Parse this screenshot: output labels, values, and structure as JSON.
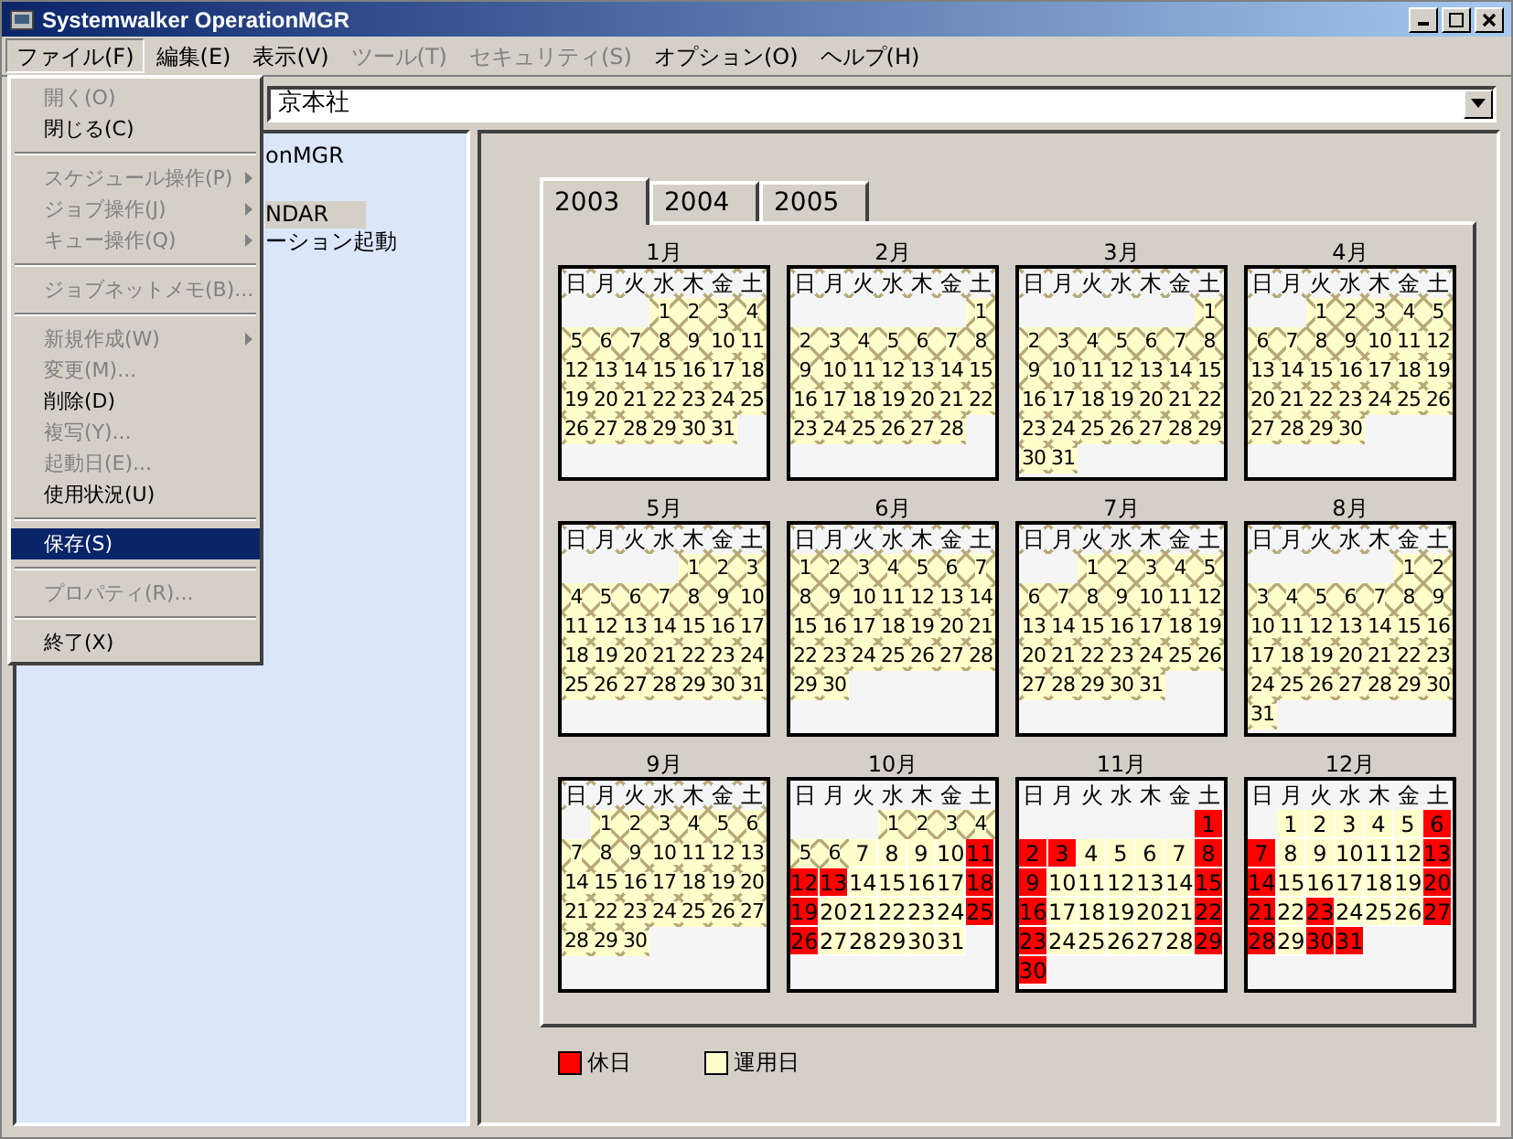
{
  "window": {
    "title": "Systemwalker OperationMGR"
  },
  "menubar": [
    {
      "label": "ファイル(F)",
      "selected": true,
      "disabled": false
    },
    {
      "label": "編集(E)",
      "selected": false,
      "disabled": false
    },
    {
      "label": "表示(V)",
      "selected": false,
      "disabled": false
    },
    {
      "label": "ツール(T)",
      "selected": false,
      "disabled": true
    },
    {
      "label": "セキュリティ(S)",
      "selected": false,
      "disabled": true
    },
    {
      "label": "オプション(O)",
      "selected": false,
      "disabled": false
    },
    {
      "label": "ヘルプ(H)",
      "selected": false,
      "disabled": false
    }
  ],
  "file_menu": [
    {
      "kind": "item",
      "label": "開く(O)",
      "disabled": true,
      "submenu": false,
      "selected": false
    },
    {
      "kind": "item",
      "label": "閉じる(C)",
      "disabled": false,
      "submenu": false,
      "selected": false
    },
    {
      "kind": "separator"
    },
    {
      "kind": "item",
      "label": "スケジュール操作(P)",
      "disabled": true,
      "submenu": true,
      "selected": false
    },
    {
      "kind": "item",
      "label": "ジョブ操作(J)",
      "disabled": true,
      "submenu": true,
      "selected": false
    },
    {
      "kind": "item",
      "label": "キュー操作(Q)",
      "disabled": true,
      "submenu": true,
      "selected": false
    },
    {
      "kind": "separator"
    },
    {
      "kind": "item",
      "label": "ジョブネットメモ(B)...",
      "disabled": true,
      "submenu": false,
      "selected": false
    },
    {
      "kind": "separator"
    },
    {
      "kind": "item",
      "label": "新規作成(W)",
      "disabled": true,
      "submenu": true,
      "selected": false
    },
    {
      "kind": "item",
      "label": "変更(M)...",
      "disabled": true,
      "submenu": false,
      "selected": false
    },
    {
      "kind": "item",
      "label": "削除(D)",
      "disabled": false,
      "submenu": false,
      "selected": false
    },
    {
      "kind": "item",
      "label": "複写(Y)...",
      "disabled": true,
      "submenu": false,
      "selected": false
    },
    {
      "kind": "item",
      "label": "起動日(E)...",
      "disabled": true,
      "submenu": false,
      "selected": false
    },
    {
      "kind": "item",
      "label": "使用状況(U)",
      "disabled": false,
      "submenu": false,
      "selected": false
    },
    {
      "kind": "separator"
    },
    {
      "kind": "item",
      "label": "保存(S)",
      "disabled": false,
      "submenu": false,
      "selected": true
    },
    {
      "kind": "separator"
    },
    {
      "kind": "item",
      "label": "プロパティ(R)...",
      "disabled": true,
      "submenu": false,
      "selected": false
    },
    {
      "kind": "separator"
    },
    {
      "kind": "item",
      "label": "終了(X)",
      "disabled": false,
      "submenu": false,
      "selected": false
    }
  ],
  "host_combo": {
    "value": "京本社"
  },
  "tree": [
    {
      "label": "onMGR",
      "selected": false
    },
    {
      "label": "NDAR",
      "selected": true
    },
    {
      "label": "ーション起動",
      "selected": false
    }
  ],
  "year_tabs": [
    {
      "label": "2003",
      "selected": true
    },
    {
      "label": "2004",
      "selected": false
    },
    {
      "label": "2005",
      "selected": false
    }
  ],
  "months": [
    {
      "label": "1月",
      "header_crossed": true,
      "weekdays": [
        "日",
        "月",
        "火",
        "水",
        "木",
        "金",
        "土"
      ],
      "days": [
        {
          "kind": "blank"
        },
        {
          "kind": "blank"
        },
        {
          "kind": "blank"
        },
        {
          "day": "1",
          "kind": "past"
        },
        {
          "day": "2",
          "kind": "past"
        },
        {
          "day": "3",
          "kind": "past"
        },
        {
          "day": "4",
          "kind": "past"
        },
        {
          "day": "5",
          "kind": "past"
        },
        {
          "day": "6",
          "kind": "past"
        },
        {
          "day": "7",
          "kind": "past"
        },
        {
          "day": "8",
          "kind": "past"
        },
        {
          "day": "9",
          "kind": "past"
        },
        {
          "day": "10",
          "kind": "past"
        },
        {
          "day": "11",
          "kind": "past"
        },
        {
          "day": "12",
          "kind": "past"
        },
        {
          "day": "13",
          "kind": "past"
        },
        {
          "day": "14",
          "kind": "past"
        },
        {
          "day": "15",
          "kind": "past"
        },
        {
          "day": "16",
          "kind": "past"
        },
        {
          "day": "17",
          "kind": "past"
        },
        {
          "day": "18",
          "kind": "past"
        },
        {
          "day": "19",
          "kind": "past"
        },
        {
          "day": "20",
          "kind": "past"
        },
        {
          "day": "21",
          "kind": "past"
        },
        {
          "day": "22",
          "kind": "past"
        },
        {
          "day": "23",
          "kind": "past"
        },
        {
          "day": "24",
          "kind": "past"
        },
        {
          "day": "25",
          "kind": "past"
        },
        {
          "day": "26",
          "kind": "past"
        },
        {
          "day": "27",
          "kind": "past"
        },
        {
          "day": "28",
          "kind": "past"
        },
        {
          "day": "29",
          "kind": "past"
        },
        {
          "day": "30",
          "kind": "past"
        },
        {
          "day": "31",
          "kind": "past"
        }
      ]
    },
    {
      "label": "2月",
      "header_crossed": true,
      "weekdays": [
        "日",
        "月",
        "火",
        "水",
        "木",
        "金",
        "土"
      ],
      "days": [
        {
          "kind": "blank"
        },
        {
          "kind": "blank"
        },
        {
          "kind": "blank"
        },
        {
          "kind": "blank"
        },
        {
          "kind": "blank"
        },
        {
          "kind": "blank"
        },
        {
          "day": "1",
          "kind": "past"
        },
        {
          "day": "2",
          "kind": "past"
        },
        {
          "day": "3",
          "kind": "past"
        },
        {
          "day": "4",
          "kind": "past"
        },
        {
          "day": "5",
          "kind": "past"
        },
        {
          "day": "6",
          "kind": "past"
        },
        {
          "day": "7",
          "kind": "past"
        },
        {
          "day": "8",
          "kind": "past"
        },
        {
          "day": "9",
          "kind": "past"
        },
        {
          "day": "10",
          "kind": "past"
        },
        {
          "day": "11",
          "kind": "past"
        },
        {
          "day": "12",
          "kind": "past"
        },
        {
          "day": "13",
          "kind": "past"
        },
        {
          "day": "14",
          "kind": "past"
        },
        {
          "day": "15",
          "kind": "past"
        },
        {
          "day": "16",
          "kind": "past"
        },
        {
          "day": "17",
          "kind": "past"
        },
        {
          "day": "18",
          "kind": "past"
        },
        {
          "day": "19",
          "kind": "past"
        },
        {
          "day": "20",
          "kind": "past"
        },
        {
          "day": "21",
          "kind": "past"
        },
        {
          "day": "22",
          "kind": "past"
        },
        {
          "day": "23",
          "kind": "past"
        },
        {
          "day": "24",
          "kind": "past"
        },
        {
          "day": "25",
          "kind": "past"
        },
        {
          "day": "26",
          "kind": "past"
        },
        {
          "day": "27",
          "kind": "past"
        },
        {
          "day": "28",
          "kind": "past"
        }
      ]
    },
    {
      "label": "3月",
      "header_crossed": true,
      "weekdays": [
        "日",
        "月",
        "火",
        "水",
        "木",
        "金",
        "土"
      ],
      "days": [
        {
          "kind": "blank"
        },
        {
          "kind": "blank"
        },
        {
          "kind": "blank"
        },
        {
          "kind": "blank"
        },
        {
          "kind": "blank"
        },
        {
          "kind": "blank"
        },
        {
          "day": "1",
          "kind": "past"
        },
        {
          "day": "2",
          "kind": "past"
        },
        {
          "day": "3",
          "kind": "past"
        },
        {
          "day": "4",
          "kind": "past"
        },
        {
          "day": "5",
          "kind": "past"
        },
        {
          "day": "6",
          "kind": "past"
        },
        {
          "day": "7",
          "kind": "past"
        },
        {
          "day": "8",
          "kind": "past"
        },
        {
          "day": "9",
          "kind": "past"
        },
        {
          "day": "10",
          "kind": "past"
        },
        {
          "day": "11",
          "kind": "past"
        },
        {
          "day": "12",
          "kind": "past"
        },
        {
          "day": "13",
          "kind": "past"
        },
        {
          "day": "14",
          "kind": "past"
        },
        {
          "day": "15",
          "kind": "past"
        },
        {
          "day": "16",
          "kind": "past"
        },
        {
          "day": "17",
          "kind": "past"
        },
        {
          "day": "18",
          "kind": "past"
        },
        {
          "day": "19",
          "kind": "past"
        },
        {
          "day": "20",
          "kind": "past"
        },
        {
          "day": "21",
          "kind": "past"
        },
        {
          "day": "22",
          "kind": "past"
        },
        {
          "day": "23",
          "kind": "past"
        },
        {
          "day": "24",
          "kind": "past"
        },
        {
          "day": "25",
          "kind": "past"
        },
        {
          "day": "26",
          "kind": "past"
        },
        {
          "day": "27",
          "kind": "past"
        },
        {
          "day": "28",
          "kind": "past"
        },
        {
          "day": "29",
          "kind": "past"
        },
        {
          "day": "30",
          "kind": "past"
        },
        {
          "day": "31",
          "kind": "past"
        }
      ]
    },
    {
      "label": "4月",
      "header_crossed": true,
      "weekdays": [
        "日",
        "月",
        "火",
        "水",
        "木",
        "金",
        "土"
      ],
      "days": [
        {
          "kind": "blank"
        },
        {
          "kind": "blank"
        },
        {
          "day": "1",
          "kind": "past"
        },
        {
          "day": "2",
          "kind": "past"
        },
        {
          "day": "3",
          "kind": "past"
        },
        {
          "day": "4",
          "kind": "past"
        },
        {
          "day": "5",
          "kind": "past"
        },
        {
          "day": "6",
          "kind": "past"
        },
        {
          "day": "7",
          "kind": "past"
        },
        {
          "day": "8",
          "kind": "past"
        },
        {
          "day": "9",
          "kind": "past"
        },
        {
          "day": "10",
          "kind": "past"
        },
        {
          "day": "11",
          "kind": "past"
        },
        {
          "day": "12",
          "kind": "past"
        },
        {
          "day": "13",
          "kind": "past"
        },
        {
          "day": "14",
          "kind": "past"
        },
        {
          "day": "15",
          "kind": "past"
        },
        {
          "day": "16",
          "kind": "past"
        },
        {
          "day": "17",
          "kind": "past"
        },
        {
          "day": "18",
          "kind": "past"
        },
        {
          "day": "19",
          "kind": "past"
        },
        {
          "day": "20",
          "kind": "past"
        },
        {
          "day": "21",
          "kind": "past"
        },
        {
          "day": "22",
          "kind": "past"
        },
        {
          "day": "23",
          "kind": "past"
        },
        {
          "day": "24",
          "kind": "past"
        },
        {
          "day": "25",
          "kind": "past"
        },
        {
          "day": "26",
          "kind": "past"
        },
        {
          "day": "27",
          "kind": "past"
        },
        {
          "day": "28",
          "kind": "past"
        },
        {
          "day": "29",
          "kind": "past"
        },
        {
          "day": "30",
          "kind": "past"
        }
      ]
    },
    {
      "label": "5月",
      "header_crossed": true,
      "weekdays": [
        "日",
        "月",
        "火",
        "水",
        "木",
        "金",
        "土"
      ],
      "days": [
        {
          "kind": "blank"
        },
        {
          "kind": "blank"
        },
        {
          "kind": "blank"
        },
        {
          "kind": "blank"
        },
        {
          "day": "1",
          "kind": "past"
        },
        {
          "day": "2",
          "kind": "past"
        },
        {
          "day": "3",
          "kind": "past"
        },
        {
          "day": "4",
          "kind": "past"
        },
        {
          "day": "5",
          "kind": "past"
        },
        {
          "day": "6",
          "kind": "past"
        },
        {
          "day": "7",
          "kind": "past"
        },
        {
          "day": "8",
          "kind": "past"
        },
        {
          "day": "9",
          "kind": "past"
        },
        {
          "day": "10",
          "kind": "past"
        },
        {
          "day": "11",
          "kind": "past"
        },
        {
          "day": "12",
          "kind": "past"
        },
        {
          "day": "13",
          "kind": "past"
        },
        {
          "day": "14",
          "kind": "past"
        },
        {
          "day": "15",
          "kind": "past"
        },
        {
          "day": "16",
          "kind": "past"
        },
        {
          "day": "17",
          "kind": "past"
        },
        {
          "day": "18",
          "kind": "past"
        },
        {
          "day": "19",
          "kind": "past"
        },
        {
          "day": "20",
          "kind": "past"
        },
        {
          "day": "21",
          "kind": "past"
        },
        {
          "day": "22",
          "kind": "past"
        },
        {
          "day": "23",
          "kind": "past"
        },
        {
          "day": "24",
          "kind": "past"
        },
        {
          "day": "25",
          "kind": "past"
        },
        {
          "day": "26",
          "kind": "past"
        },
        {
          "day": "27",
          "kind": "past"
        },
        {
          "day": "28",
          "kind": "past"
        },
        {
          "day": "29",
          "kind": "past"
        },
        {
          "day": "30",
          "kind": "past"
        },
        {
          "day": "31",
          "kind": "past"
        }
      ]
    },
    {
      "label": "6月",
      "header_crossed": true,
      "weekdays": [
        "日",
        "月",
        "火",
        "水",
        "木",
        "金",
        "土"
      ],
      "days": [
        {
          "day": "1",
          "kind": "past"
        },
        {
          "day": "2",
          "kind": "past"
        },
        {
          "day": "3",
          "kind": "past"
        },
        {
          "day": "4",
          "kind": "past"
        },
        {
          "day": "5",
          "kind": "past"
        },
        {
          "day": "6",
          "kind": "past"
        },
        {
          "day": "7",
          "kind": "past"
        },
        {
          "day": "8",
          "kind": "past"
        },
        {
          "day": "9",
          "kind": "past"
        },
        {
          "day": "10",
          "kind": "past"
        },
        {
          "day": "11",
          "kind": "past"
        },
        {
          "day": "12",
          "kind": "past"
        },
        {
          "day": "13",
          "kind": "past"
        },
        {
          "day": "14",
          "kind": "past"
        },
        {
          "day": "15",
          "kind": "past"
        },
        {
          "day": "16",
          "kind": "past"
        },
        {
          "day": "17",
          "kind": "past"
        },
        {
          "day": "18",
          "kind": "past"
        },
        {
          "day": "19",
          "kind": "past"
        },
        {
          "day": "20",
          "kind": "past"
        },
        {
          "day": "21",
          "kind": "past"
        },
        {
          "day": "22",
          "kind": "past"
        },
        {
          "day": "23",
          "kind": "past"
        },
        {
          "day": "24",
          "kind": "past"
        },
        {
          "day": "25",
          "kind": "past"
        },
        {
          "day": "26",
          "kind": "past"
        },
        {
          "day": "27",
          "kind": "past"
        },
        {
          "day": "28",
          "kind": "past"
        },
        {
          "day": "29",
          "kind": "past"
        },
        {
          "day": "30",
          "kind": "past"
        }
      ]
    },
    {
      "label": "7月",
      "header_crossed": true,
      "weekdays": [
        "日",
        "月",
        "火",
        "水",
        "木",
        "金",
        "土"
      ],
      "days": [
        {
          "kind": "blank"
        },
        {
          "kind": "blank"
        },
        {
          "day": "1",
          "kind": "past"
        },
        {
          "day": "2",
          "kind": "past"
        },
        {
          "day": "3",
          "kind": "past"
        },
        {
          "day": "4",
          "kind": "past"
        },
        {
          "day": "5",
          "kind": "past"
        },
        {
          "day": "6",
          "kind": "past"
        },
        {
          "day": "7",
          "kind": "past"
        },
        {
          "day": "8",
          "kind": "past"
        },
        {
          "day": "9",
          "kind": "past"
        },
        {
          "day": "10",
          "kind": "past"
        },
        {
          "day": "11",
          "kind": "past"
        },
        {
          "day": "12",
          "kind": "past"
        },
        {
          "day": "13",
          "kind": "past"
        },
        {
          "day": "14",
          "kind": "past"
        },
        {
          "day": "15",
          "kind": "past"
        },
        {
          "day": "16",
          "kind": "past"
        },
        {
          "day": "17",
          "kind": "past"
        },
        {
          "day": "18",
          "kind": "past"
        },
        {
          "day": "19",
          "kind": "past"
        },
        {
          "day": "20",
          "kind": "past"
        },
        {
          "day": "21",
          "kind": "past"
        },
        {
          "day": "22",
          "kind": "past"
        },
        {
          "day": "23",
          "kind": "past"
        },
        {
          "day": "24",
          "kind": "past"
        },
        {
          "day": "25",
          "kind": "past"
        },
        {
          "day": "26",
          "kind": "past"
        },
        {
          "day": "27",
          "kind": "past"
        },
        {
          "day": "28",
          "kind": "past"
        },
        {
          "day": "29",
          "kind": "past"
        },
        {
          "day": "30",
          "kind": "past"
        },
        {
          "day": "31",
          "kind": "past"
        }
      ]
    },
    {
      "label": "8月",
      "header_crossed": true,
      "weekdays": [
        "日",
        "月",
        "火",
        "水",
        "木",
        "金",
        "土"
      ],
      "days": [
        {
          "kind": "blank"
        },
        {
          "kind": "blank"
        },
        {
          "kind": "blank"
        },
        {
          "kind": "blank"
        },
        {
          "kind": "blank"
        },
        {
          "day": "1",
          "kind": "past"
        },
        {
          "day": "2",
          "kind": "past"
        },
        {
          "day": "3",
          "kind": "past"
        },
        {
          "day": "4",
          "kind": "past"
        },
        {
          "day": "5",
          "kind": "past"
        },
        {
          "day": "6",
          "kind": "past"
        },
        {
          "day": "7",
          "kind": "past"
        },
        {
          "day": "8",
          "kind": "past"
        },
        {
          "day": "9",
          "kind": "past"
        },
        {
          "day": "10",
          "kind": "past"
        },
        {
          "day": "11",
          "kind": "past"
        },
        {
          "day": "12",
          "kind": "past"
        },
        {
          "day": "13",
          "kind": "past"
        },
        {
          "day": "14",
          "kind": "past"
        },
        {
          "day": "15",
          "kind": "past"
        },
        {
          "day": "16",
          "kind": "past"
        },
        {
          "day": "17",
          "kind": "past"
        },
        {
          "day": "18",
          "kind": "past"
        },
        {
          "day": "19",
          "kind": "past"
        },
        {
          "day": "20",
          "kind": "past"
        },
        {
          "day": "21",
          "kind": "past"
        },
        {
          "day": "22",
          "kind": "past"
        },
        {
          "day": "23",
          "kind": "past"
        },
        {
          "day": "24",
          "kind": "past"
        },
        {
          "day": "25",
          "kind": "past"
        },
        {
          "day": "26",
          "kind": "past"
        },
        {
          "day": "27",
          "kind": "past"
        },
        {
          "day": "28",
          "kind": "past"
        },
        {
          "day": "29",
          "kind": "past"
        },
        {
          "day": "30",
          "kind": "past"
        },
        {
          "day": "31",
          "kind": "past"
        }
      ]
    },
    {
      "label": "9月",
      "header_crossed": true,
      "weekdays": [
        "日",
        "月",
        "火",
        "水",
        "木",
        "金",
        "土"
      ],
      "days": [
        {
          "kind": "blank"
        },
        {
          "day": "1",
          "kind": "past"
        },
        {
          "day": "2",
          "kind": "past"
        },
        {
          "day": "3",
          "kind": "past"
        },
        {
          "day": "4",
          "kind": "past"
        },
        {
          "day": "5",
          "kind": "past"
        },
        {
          "day": "6",
          "kind": "past"
        },
        {
          "day": "7",
          "kind": "past"
        },
        {
          "day": "8",
          "kind": "past"
        },
        {
          "day": "9",
          "kind": "past"
        },
        {
          "day": "10",
          "kind": "past"
        },
        {
          "day": "11",
          "kind": "past"
        },
        {
          "day": "12",
          "kind": "past"
        },
        {
          "day": "13",
          "kind": "past"
        },
        {
          "day": "14",
          "kind": "past"
        },
        {
          "day": "15",
          "kind": "past"
        },
        {
          "day": "16",
          "kind": "past"
        },
        {
          "day": "17",
          "kind": "past"
        },
        {
          "day": "18",
          "kind": "past"
        },
        {
          "day": "19",
          "kind": "past"
        },
        {
          "day": "20",
          "kind": "past"
        },
        {
          "day": "21",
          "kind": "past"
        },
        {
          "day": "22",
          "kind": "past"
        },
        {
          "day": "23",
          "kind": "past"
        },
        {
          "day": "24",
          "kind": "past"
        },
        {
          "day": "25",
          "kind": "past"
        },
        {
          "day": "26",
          "kind": "past"
        },
        {
          "day": "27",
          "kind": "past"
        },
        {
          "day": "28",
          "kind": "past"
        },
        {
          "day": "29",
          "kind": "past"
        },
        {
          "day": "30",
          "kind": "past"
        }
      ]
    },
    {
      "label": "10月",
      "header_crossed": false,
      "weekdays": [
        "日",
        "月",
        "火",
        "水",
        "木",
        "金",
        "土"
      ],
      "days": [
        {
          "kind": "blank"
        },
        {
          "kind": "blank"
        },
        {
          "kind": "blank"
        },
        {
          "day": "1",
          "kind": "past"
        },
        {
          "day": "2",
          "kind": "past"
        },
        {
          "day": "3",
          "kind": "past"
        },
        {
          "day": "4",
          "kind": "past"
        },
        {
          "day": "5",
          "kind": "past"
        },
        {
          "day": "6",
          "kind": "past"
        },
        {
          "day": "7",
          "kind": "workday"
        },
        {
          "day": "8",
          "kind": "workday"
        },
        {
          "day": "9",
          "kind": "workday"
        },
        {
          "day": "10",
          "kind": "workday"
        },
        {
          "day": "11",
          "kind": "holiday"
        },
        {
          "day": "12",
          "kind": "holiday"
        },
        {
          "day": "13",
          "kind": "holiday"
        },
        {
          "day": "14",
          "kind": "workday"
        },
        {
          "day": "15",
          "kind": "workday"
        },
        {
          "day": "16",
          "kind": "workday"
        },
        {
          "day": "17",
          "kind": "workday"
        },
        {
          "day": "18",
          "kind": "holiday"
        },
        {
          "day": "19",
          "kind": "holiday"
        },
        {
          "day": "20",
          "kind": "workday"
        },
        {
          "day": "21",
          "kind": "workday"
        },
        {
          "day": "22",
          "kind": "workday"
        },
        {
          "day": "23",
          "kind": "workday"
        },
        {
          "day": "24",
          "kind": "workday"
        },
        {
          "day": "25",
          "kind": "holiday"
        },
        {
          "day": "26",
          "kind": "holiday"
        },
        {
          "day": "27",
          "kind": "workday"
        },
        {
          "day": "28",
          "kind": "workday"
        },
        {
          "day": "29",
          "kind": "workday"
        },
        {
          "day": "30",
          "kind": "workday"
        },
        {
          "day": "31",
          "kind": "workday"
        }
      ]
    },
    {
      "label": "11月",
      "header_crossed": false,
      "weekdays": [
        "日",
        "月",
        "火",
        "水",
        "木",
        "金",
        "土"
      ],
      "days": [
        {
          "kind": "blank"
        },
        {
          "kind": "blank"
        },
        {
          "kind": "blank"
        },
        {
          "kind": "blank"
        },
        {
          "kind": "blank"
        },
        {
          "kind": "blank"
        },
        {
          "day": "1",
          "kind": "holiday"
        },
        {
          "day": "2",
          "kind": "holiday"
        },
        {
          "day": "3",
          "kind": "holiday"
        },
        {
          "day": "4",
          "kind": "workday"
        },
        {
          "day": "5",
          "kind": "workday"
        },
        {
          "day": "6",
          "kind": "workday"
        },
        {
          "day": "7",
          "kind": "workday"
        },
        {
          "day": "8",
          "kind": "holiday"
        },
        {
          "day": "9",
          "kind": "holiday"
        },
        {
          "day": "10",
          "kind": "workday"
        },
        {
          "day": "11",
          "kind": "workday"
        },
        {
          "day": "12",
          "kind": "workday"
        },
        {
          "day": "13",
          "kind": "workday"
        },
        {
          "day": "14",
          "kind": "workday"
        },
        {
          "day": "15",
          "kind": "holiday"
        },
        {
          "day": "16",
          "kind": "holiday"
        },
        {
          "day": "17",
          "kind": "workday"
        },
        {
          "day": "18",
          "kind": "workday"
        },
        {
          "day": "19",
          "kind": "workday"
        },
        {
          "day": "20",
          "kind": "workday"
        },
        {
          "day": "21",
          "kind": "workday"
        },
        {
          "day": "22",
          "kind": "holiday"
        },
        {
          "day": "23",
          "kind": "holiday"
        },
        {
          "day": "24",
          "kind": "workday"
        },
        {
          "day": "25",
          "kind": "workday"
        },
        {
          "day": "26",
          "kind": "workday"
        },
        {
          "day": "27",
          "kind": "workday"
        },
        {
          "day": "28",
          "kind": "workday"
        },
        {
          "day": "29",
          "kind": "holiday"
        },
        {
          "day": "30",
          "kind": "holiday"
        }
      ]
    },
    {
      "label": "12月",
      "header_crossed": false,
      "weekdays": [
        "日",
        "月",
        "火",
        "水",
        "木",
        "金",
        "土"
      ],
      "days": [
        {
          "kind": "blank"
        },
        {
          "day": "1",
          "kind": "workday"
        },
        {
          "day": "2",
          "kind": "workday"
        },
        {
          "day": "3",
          "kind": "workday"
        },
        {
          "day": "4",
          "kind": "workday"
        },
        {
          "day": "5",
          "kind": "workday"
        },
        {
          "day": "6",
          "kind": "holiday"
        },
        {
          "day": "7",
          "kind": "holiday"
        },
        {
          "day": "8",
          "kind": "workday"
        },
        {
          "day": "9",
          "kind": "workday"
        },
        {
          "day": "10",
          "kind": "workday"
        },
        {
          "day": "11",
          "kind": "workday"
        },
        {
          "day": "12",
          "kind": "workday"
        },
        {
          "day": "13",
          "kind": "holiday"
        },
        {
          "day": "14",
          "kind": "holiday"
        },
        {
          "day": "15",
          "kind": "workday"
        },
        {
          "day": "16",
          "kind": "workday"
        },
        {
          "day": "17",
          "kind": "workday"
        },
        {
          "day": "18",
          "kind": "workday"
        },
        {
          "day": "19",
          "kind": "workday"
        },
        {
          "day": "20",
          "kind": "holiday"
        },
        {
          "day": "21",
          "kind": "holiday"
        },
        {
          "day": "22",
          "kind": "workday"
        },
        {
          "day": "23",
          "kind": "holiday"
        },
        {
          "day": "24",
          "kind": "workday"
        },
        {
          "day": "25",
          "kind": "workday"
        },
        {
          "day": "26",
          "kind": "workday"
        },
        {
          "day": "27",
          "kind": "holiday"
        },
        {
          "day": "28",
          "kind": "holiday"
        },
        {
          "day": "29",
          "kind": "workday"
        },
        {
          "day": "30",
          "kind": "holiday"
        },
        {
          "day": "31",
          "kind": "holiday"
        }
      ]
    }
  ],
  "legend": [
    {
      "label": "休日",
      "color": "#ff0000"
    },
    {
      "label": "運用日",
      "color": "#ffffcc"
    }
  ]
}
